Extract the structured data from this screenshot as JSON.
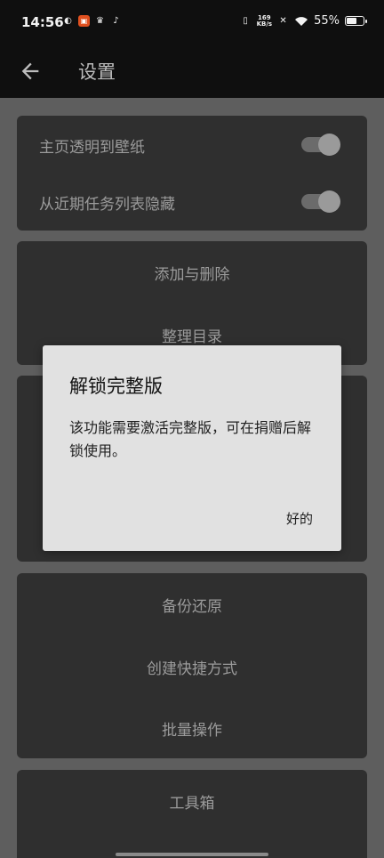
{
  "status_bar": {
    "time": "14:56",
    "net_speed_value": "169",
    "net_speed_unit": "KB/s",
    "battery": "55%"
  },
  "app_bar": {
    "title": "设置"
  },
  "settings": {
    "toggles": [
      {
        "label": "主页透明到壁纸",
        "on": true
      },
      {
        "label": "从近期任务列表隐藏",
        "on": true
      }
    ],
    "group2": [
      "添加与删除",
      "整理目录"
    ],
    "group4": [
      "备份还原",
      "创建快捷方式",
      "批量操作"
    ],
    "group5": [
      "工具箱"
    ]
  },
  "dialog": {
    "title": "解锁完整版",
    "message": "该功能需要激活完整版，可在捐赠后解锁使用。",
    "ok_label": "好的"
  },
  "colors": {
    "background_dim": "#5e5e5e",
    "card": "#2f2f2f",
    "dialog": "#e1e1e1"
  }
}
